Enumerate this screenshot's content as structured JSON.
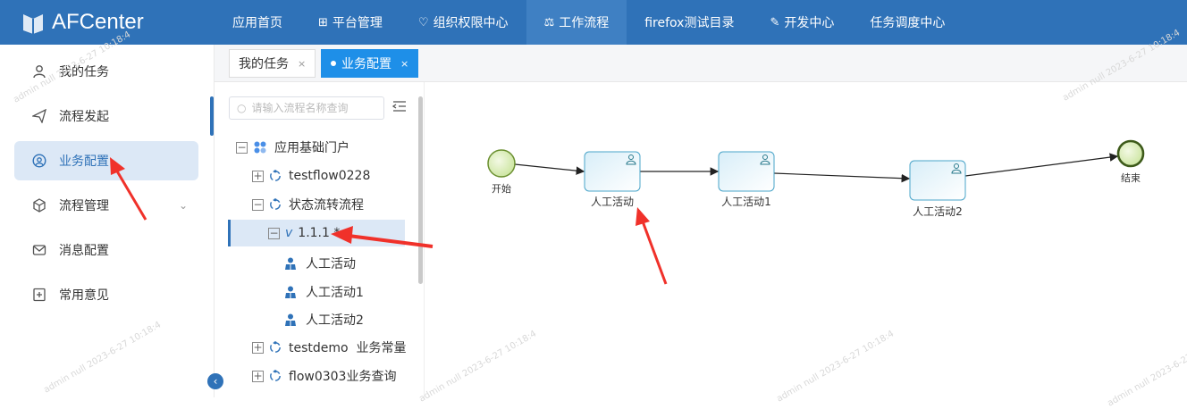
{
  "app": {
    "title": "AFCenter"
  },
  "nav": [
    {
      "label": "应用首页",
      "icon": ""
    },
    {
      "label": "平台管理",
      "icon": "grid-icon"
    },
    {
      "label": "组织权限中心",
      "icon": "shield-icon"
    },
    {
      "label": "工作流程",
      "icon": "flow-icon",
      "active": true
    },
    {
      "label": "firefox测试目录",
      "icon": ""
    },
    {
      "label": "开发中心",
      "icon": "edit-icon"
    },
    {
      "label": "任务调度中心",
      "icon": ""
    }
  ],
  "sidebar": {
    "items": [
      {
        "label": "我的任务",
        "icon": "user-icon"
      },
      {
        "label": "流程发起",
        "icon": "send-icon"
      },
      {
        "label": "业务配置",
        "icon": "user-circle-icon",
        "active": true
      },
      {
        "label": "流程管理",
        "icon": "cube-icon",
        "has_children": true
      },
      {
        "label": "消息配置",
        "icon": "mail-icon"
      },
      {
        "label": "常用意见",
        "icon": "plus-square-icon"
      }
    ]
  },
  "tabs": [
    {
      "label": "我的任务",
      "close": "×"
    },
    {
      "label": "业务配置",
      "close": "×",
      "active": true
    }
  ],
  "tree": {
    "search_placeholder": "请输入流程名称查询",
    "nodes": [
      {
        "label": "应用基础门户",
        "toggle": "−"
      },
      {
        "label": "testflow0228",
        "toggle": "+"
      },
      {
        "label": "状态流转流程",
        "toggle": "−"
      },
      {
        "label": "1.1.1 *",
        "toggle": "−",
        "prefix": "v",
        "selected": true
      },
      {
        "label": "人工活动"
      },
      {
        "label": "人工活动1"
      },
      {
        "label": "人工活动2"
      },
      {
        "label": "testdemo  业务常量",
        "toggle": "+"
      },
      {
        "label": "flow0303业务查询",
        "toggle": "+"
      }
    ]
  },
  "diagram": {
    "start_label": "开始",
    "end_label": "结束",
    "tasks": [
      "人工活动",
      "人工活动1",
      "人工活动2"
    ]
  },
  "watermark": {
    "text": "admin null 2023-6-27 10:18:4"
  },
  "colors": {
    "primary": "#2f72b8",
    "tab_active": "#1e8fe8",
    "arrow_red": "#f0312a",
    "event_fill": "#d9ebb0",
    "event_stroke": "#6a8f2f",
    "task_fill": "#eaf5fb",
    "task_stroke": "#4aa5c9"
  }
}
